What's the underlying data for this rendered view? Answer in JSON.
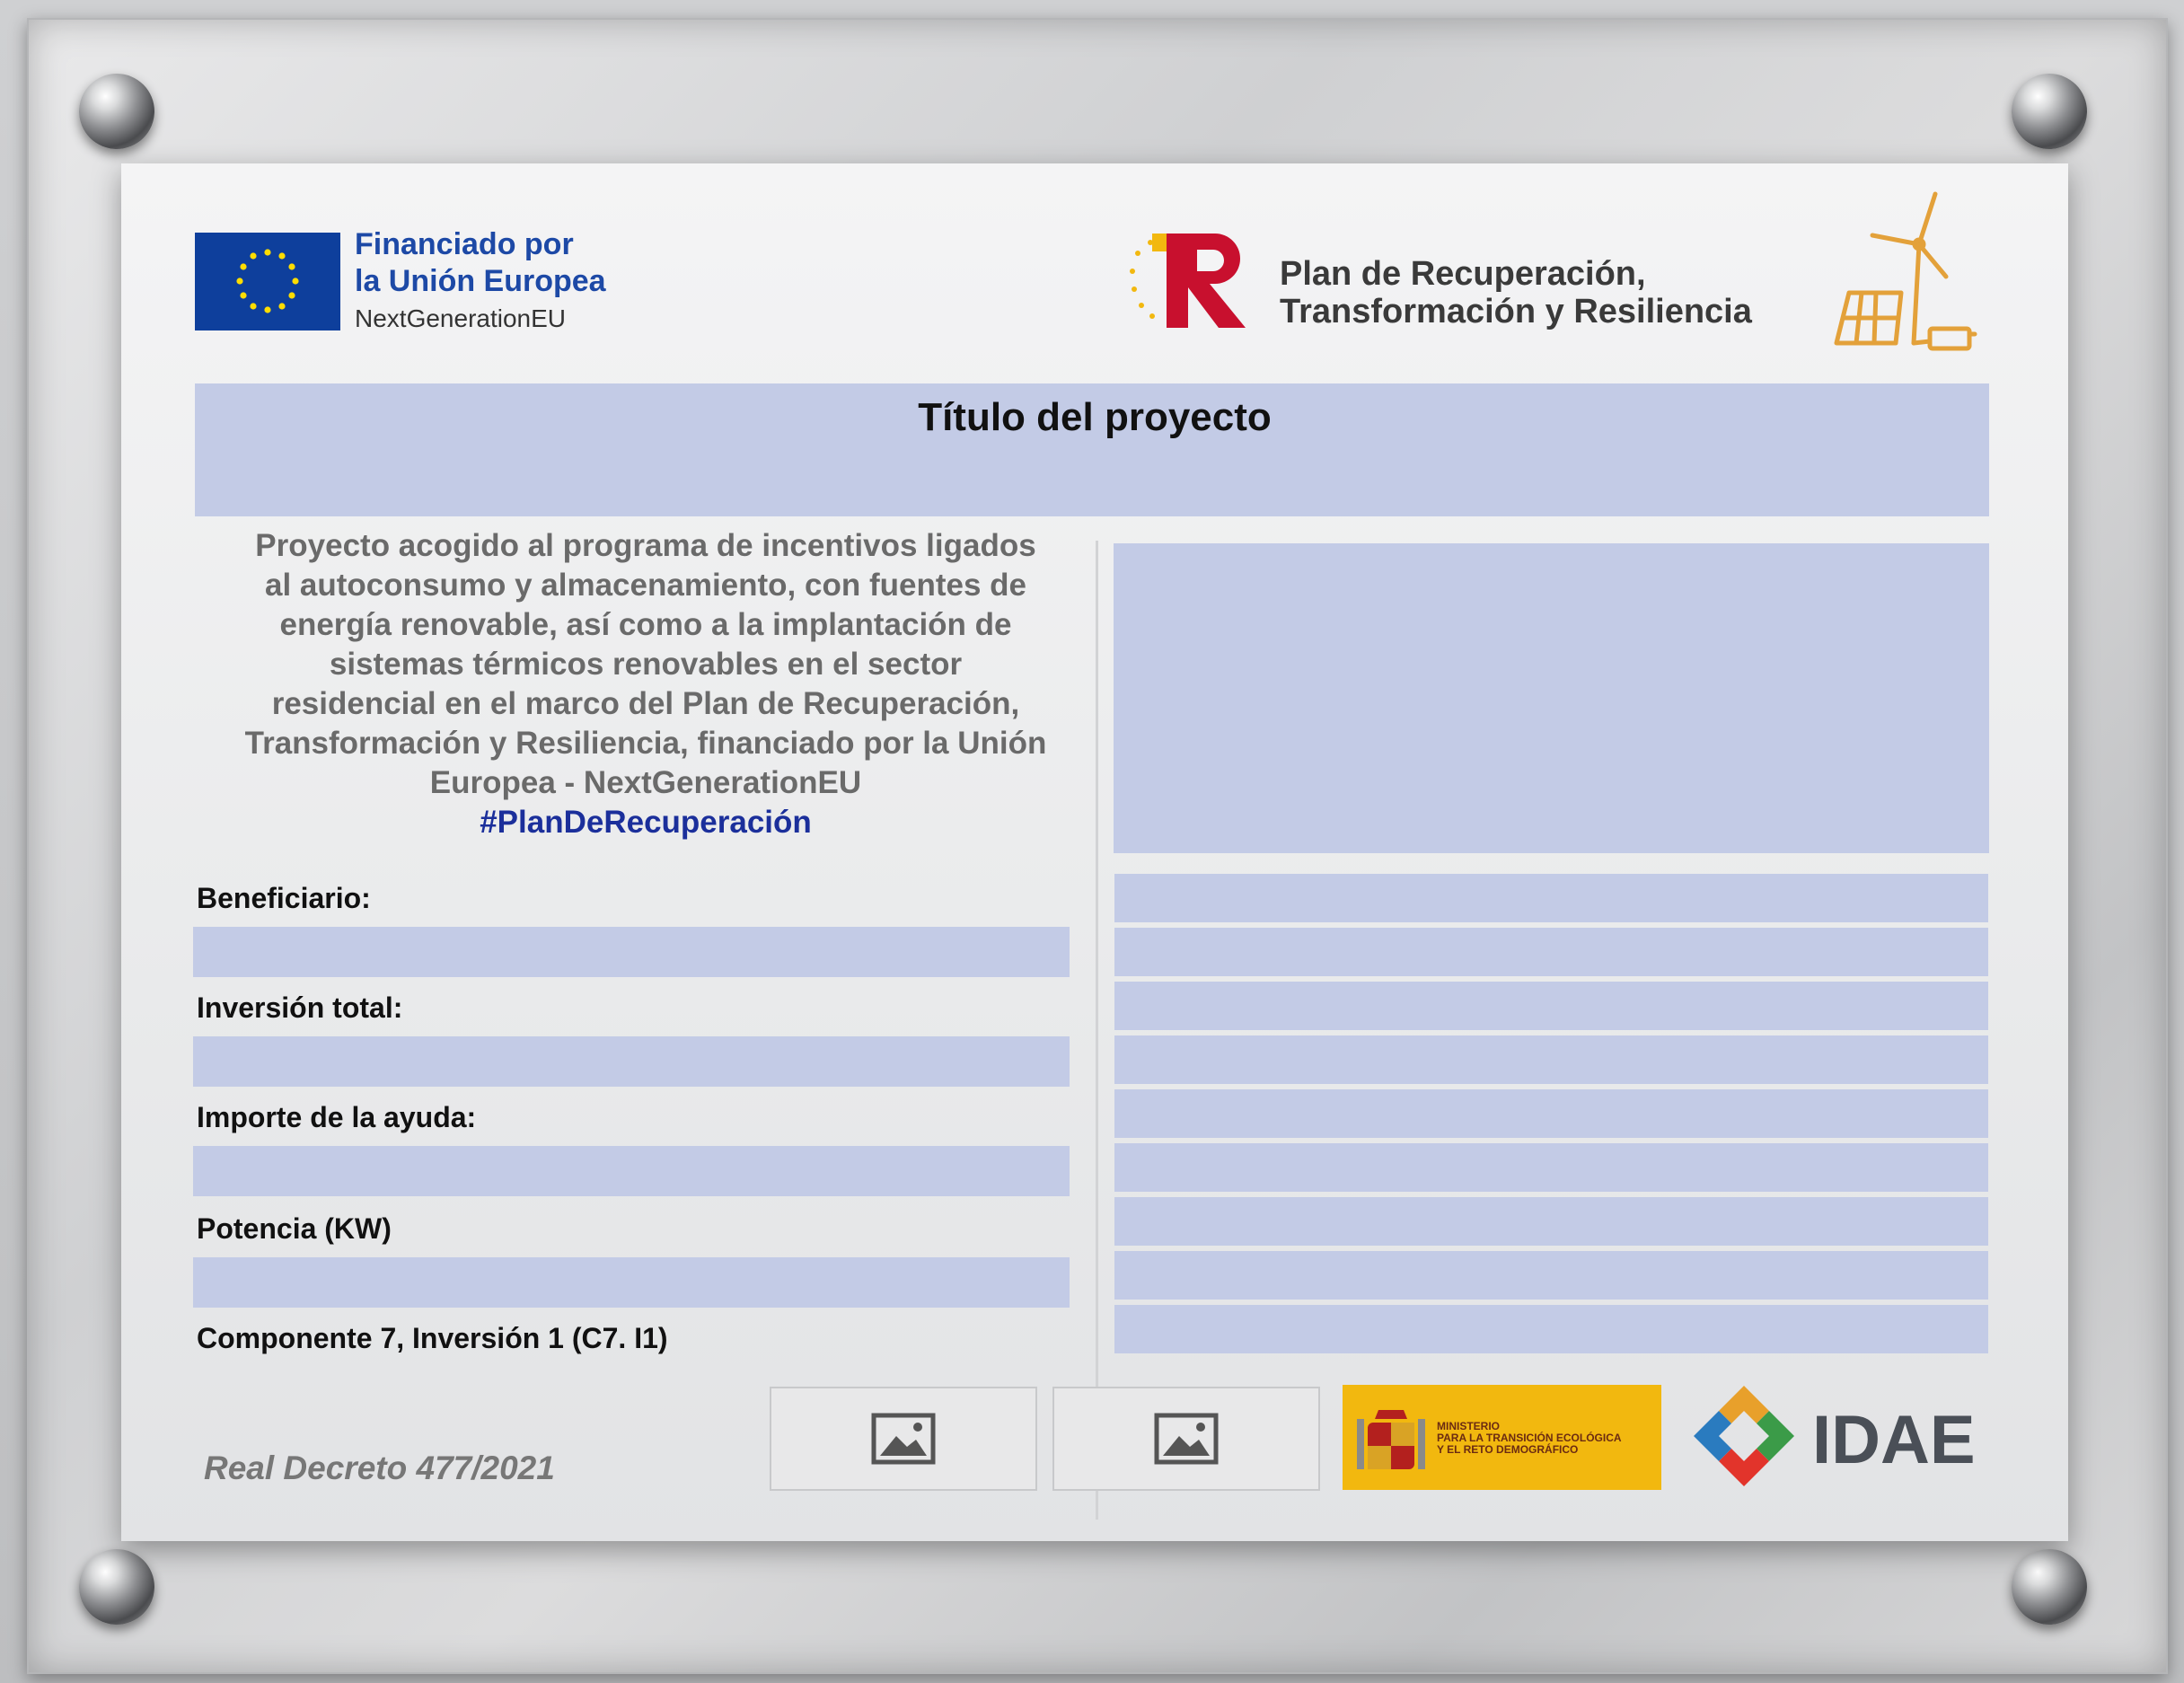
{
  "eu": {
    "line1": "Financiado por",
    "line2": "la Unión Europea",
    "line3": "NextGenerationEU",
    "flag_color": "#0e3f9c",
    "star_color": "#ffdd00"
  },
  "plan": {
    "line1": "Plan de Recuperación,",
    "line2": "Transformación y Resiliencia"
  },
  "title": "Título del proyecto",
  "description": [
    "Proyecto acogido al programa de incentivos ligados",
    "al autoconsumo  y    almacenamiento, con fuentes de",
    "energía renovable, así como a la implantación de",
    "sistemas térmicos renovables en el sector",
    "residencial en el marco del  Plan de Recuperación,",
    "Transformación y Resiliencia, financiado por la Unión",
    "Europea - NextGenerationEU"
  ],
  "hashtag": "#PlanDeRecuperación",
  "fields": {
    "beneficiario": "Beneficiario:",
    "inversion": "Inversión total:",
    "importe": "Importe de la ayuda:",
    "potencia": "Potencia (KW)",
    "componente": "Componente 7, Inversión 1 (C7. I1)"
  },
  "decreto": "Real Decreto 477/2021",
  "ministry": {
    "line1": "MINISTERIO",
    "line2": "PARA LA TRANSICIÓN ECOLÓGICA",
    "line3": "Y EL RETO DEMOGRÁFICO",
    "bg_color": "#f2b80f"
  },
  "idae": "IDAE",
  "colors": {
    "fill_blue": "#c3cbe6",
    "tr_red": "#c8102e",
    "tr_gold": "#f2b80f",
    "hashtag_blue": "#1b2f9b"
  },
  "icons": [
    "image-placeholder-icon",
    "image-placeholder-icon"
  ]
}
